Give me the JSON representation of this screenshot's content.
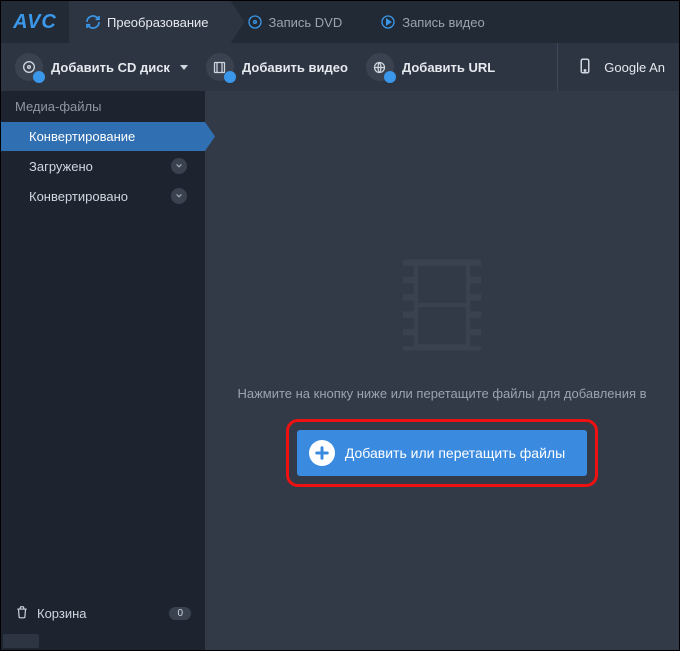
{
  "brand": "AVC",
  "tabs": [
    {
      "label": "Преобразование",
      "active": true
    },
    {
      "label": "Запись DVD",
      "active": false
    },
    {
      "label": "Запись видео",
      "active": false
    }
  ],
  "toolbar": {
    "add_cd": "Добавить CD диск",
    "add_video": "Добавить видео",
    "add_url": "Добавить URL",
    "device": "Google An"
  },
  "sidebar": {
    "section": "Медиа-файлы",
    "items": [
      {
        "label": "Конвертирование",
        "active": true,
        "badge": false
      },
      {
        "label": "Загружено",
        "active": false,
        "badge": true
      },
      {
        "label": "Конвертировано",
        "active": false,
        "badge": true
      }
    ],
    "trash_label": "Корзина",
    "trash_count": "0"
  },
  "main": {
    "hint": "Нажмите на кнопку ниже или перетащите файлы для добавления в",
    "add_button": "Добавить или перетащить файлы"
  }
}
